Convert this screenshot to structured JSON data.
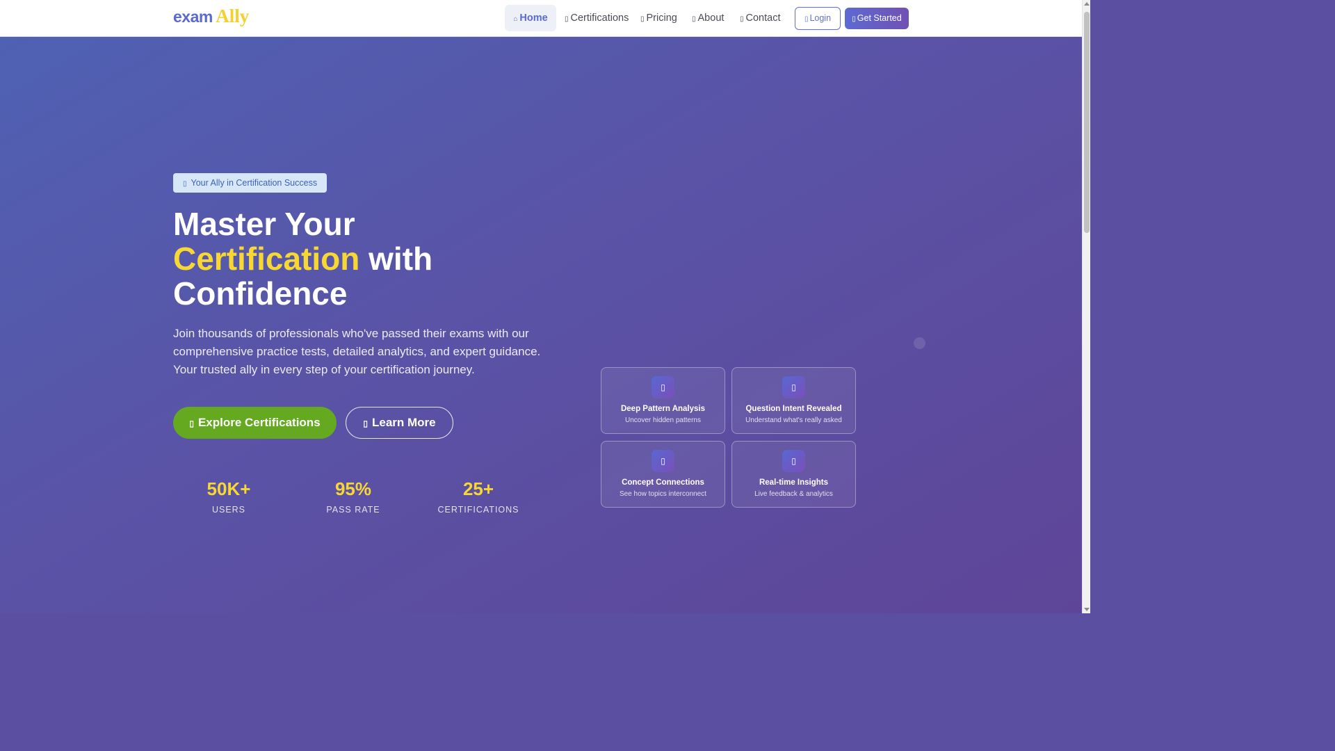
{
  "brand": {
    "part1": "exam",
    "part2": "Ally"
  },
  "nav": {
    "home": "Home",
    "certifications": "Certifications",
    "pricing": "Pricing",
    "about": "About",
    "contact": "Contact",
    "login": "Login",
    "get_started": "Get Started",
    "active": "Home"
  },
  "icons": {
    "home": "home-icon",
    "certifications": "certificate-icon",
    "pricing": "tag-icon",
    "about": "info-icon",
    "contact": "envelope-icon",
    "login": "sign-in-icon",
    "get_started": "rocket-icon",
    "badge": "shield-icon",
    "explore": "compass-icon",
    "learn": "info-circle-icon"
  },
  "hero": {
    "badge": "Your Ally in Certification Success",
    "headline_1": "Master Your",
    "headline_highlight": "Certification",
    "headline_2": "with",
    "headline_3": "Confidence",
    "description": "Join thousands of professionals who've passed their exams with our comprehensive practice tests, detailed analytics, and expert guidance. Your trusted ally in every step of your certification journey.",
    "explore_button": "Explore Certifications",
    "learn_button": "Learn More"
  },
  "stats": [
    {
      "value": "50K+",
      "label": "USERS"
    },
    {
      "value": "95%",
      "label": "PASS RATE"
    },
    {
      "value": "25+",
      "label": "CERTIFICATIONS"
    }
  ],
  "features": [
    {
      "title": "Deep Pattern Analysis",
      "subtitle": "Uncover hidden patterns",
      "icon": "chart-icon"
    },
    {
      "title": "Question Intent Revealed",
      "subtitle": "Understand what's really asked",
      "icon": "lightbulb-icon"
    },
    {
      "title": "Concept Connections",
      "subtitle": "See how topics interconnect",
      "icon": "network-icon"
    },
    {
      "title": "Real-time Insights",
      "subtitle": "Live feedback & analytics",
      "icon": "pulse-icon"
    }
  ],
  "colors": {
    "brand_blue": "#5b6ad0",
    "brand_yellow": "#f5cf2c",
    "hero_gradient_start": "#4f61b3",
    "hero_gradient_end": "#5e4598",
    "accent_yellow": "#f7d733",
    "cta_green": "#64a91f"
  }
}
